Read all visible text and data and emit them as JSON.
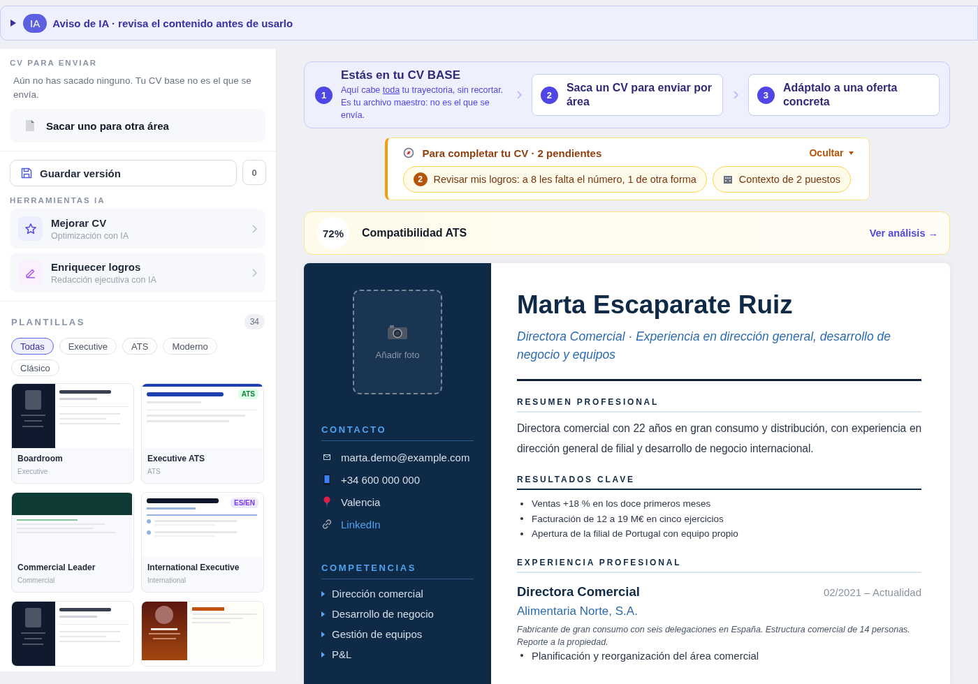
{
  "banner": {
    "expanded": false,
    "badge": "IA",
    "text": "Aviso de IA · revisa el contenido antes de usarlo"
  },
  "sidebar": {
    "send": {
      "title": "CV PARA ENVIAR",
      "note": "Aún no has sacado ninguno. Tu CV base no es el que se envía.",
      "action": "Sacar uno para otra área"
    },
    "save": {
      "label": "Guardar versión",
      "count": "0"
    },
    "tools": {
      "title": "HERRAMIENTAS IA",
      "items": [
        {
          "kind": "star",
          "title": "Mejorar CV",
          "subtitle": "Optimización con IA"
        },
        {
          "kind": "pen",
          "title": "Enriquecer logros",
          "subtitle": "Redacción ejecutiva con IA"
        }
      ]
    },
    "templates": {
      "title": "PLANTILLAS",
      "count": "34",
      "filters": [
        {
          "label": "Todas",
          "selected": true
        },
        {
          "label": "Executive",
          "selected": false
        },
        {
          "label": "ATS",
          "selected": false
        },
        {
          "label": "Moderno",
          "selected": false
        },
        {
          "label": "Clásico",
          "selected": false
        }
      ],
      "items": [
        {
          "kind": "dark-sidebar",
          "name": "Boardroom",
          "category": "Executive"
        },
        {
          "kind": "blue-top",
          "name": "Executive ATS",
          "category": "ATS",
          "badge": "ATS"
        },
        {
          "kind": "green-header",
          "name": "Commercial Leader",
          "category": "Commercial"
        },
        {
          "kind": "bilingual",
          "name": "International Executive",
          "category": "International",
          "badge": "ES/EN"
        },
        {
          "kind": "dark-sidebar"
        },
        {
          "kind": "warm-photo"
        }
      ]
    }
  },
  "steps": [
    {
      "number": "1",
      "selected": true,
      "title": "Estás en tu CV BASE",
      "text_before": "Aquí cabe ",
      "link": "toda",
      "text_after": " tu trayectoria, sin recortar. Es tu archivo maestro: no es el que se envía."
    },
    {
      "number": "2",
      "selected": false,
      "title": "Saca un CV para enviar por área"
    },
    {
      "number": "3",
      "selected": false,
      "title": "Adáptalo a una oferta concreta"
    }
  ],
  "pending": {
    "title": "Para completar tu CV · 2 pendientes",
    "toggle": "Ocultar",
    "items": [
      {
        "kind": "count",
        "badge": "2",
        "text": "Revisar mis logros: a 8 les falta el número, 1 de otra forma"
      },
      {
        "kind": "building",
        "text": "Contexto de 2 puestos"
      }
    ]
  },
  "ats": {
    "score": "72%",
    "label": "Compatibilidad ATS",
    "link": "Ver análisis →"
  },
  "cv": {
    "photo": {
      "label": "Añadir foto"
    },
    "contact": {
      "title": "CONTACTO",
      "items": [
        {
          "kind": "email",
          "text": "marta.demo@example.com"
        },
        {
          "kind": "phone",
          "text": "+34 600 000 000"
        },
        {
          "kind": "location",
          "text": "Valencia"
        },
        {
          "kind": "link",
          "text": "LinkedIn"
        }
      ]
    },
    "skills": {
      "title": "COMPETENCIAS",
      "items": [
        "Dirección comercial",
        "Desarrollo de negocio",
        "Gestión de equipos",
        "P&L"
      ]
    },
    "name": "Marta Escaparate Ruiz",
    "headline": "Directora Comercial · Experiencia en dirección general, desarrollo de negocio y equipos",
    "summary": {
      "title": "RESUMEN PROFESIONAL",
      "text": "Directora comercial con 22 años en gran consumo y distribución, con experiencia en dirección general de filial y desarrollo de negocio internacional."
    },
    "results": {
      "title": "RESULTADOS CLAVE",
      "items": [
        "Ventas +18 % en los doce primeros meses",
        "Facturación de 12 a 19 M€ en cinco ejercicios",
        "Apertura de la filial de Portugal con equipo propio"
      ]
    },
    "experience": {
      "title": "EXPERIENCIA PROFESIONAL",
      "jobs": [
        {
          "role": "Directora Comercial",
          "dates": "02/2021 – Actualidad",
          "company": "Alimentaria Norte, S.A.",
          "context": "Fabricante de gran consumo con seis delegaciones en España. Estructura comercial de 14 personas. Reporte a la propiedad.",
          "bullets": [
            "Planificación y reorganización del área comercial"
          ]
        }
      ]
    }
  }
}
